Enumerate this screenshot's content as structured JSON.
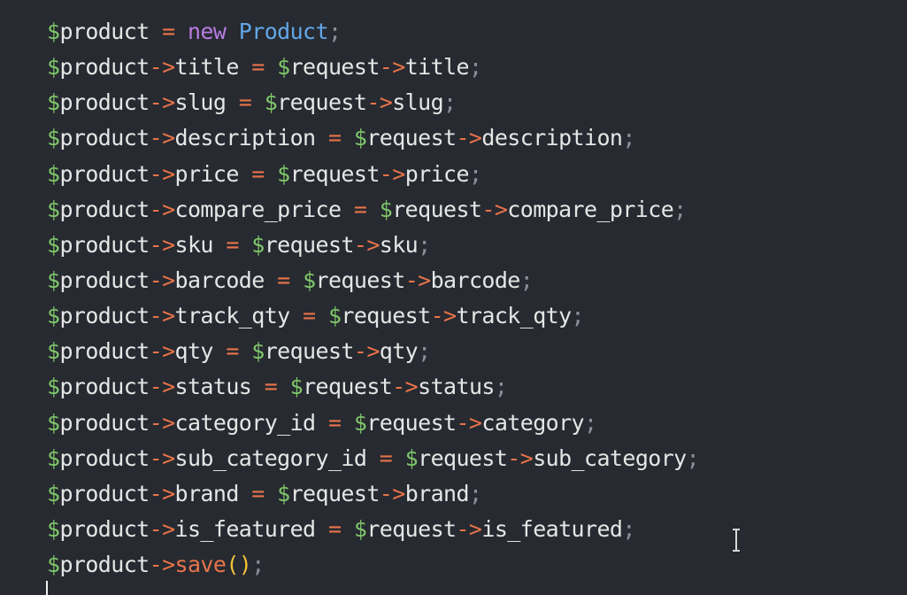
{
  "code": {
    "line1": {
      "var": "product",
      "op": " = ",
      "kw": "new",
      "cls": "Product",
      "semi": ";"
    },
    "lines": [
      {
        "prop": "title",
        "rhs": "title"
      },
      {
        "prop": "slug",
        "rhs": "slug"
      },
      {
        "prop": "description",
        "rhs": "description"
      },
      {
        "prop": "price",
        "rhs": "price"
      },
      {
        "prop": "compare_price",
        "rhs": "compare_price"
      },
      {
        "prop": "sku",
        "rhs": "sku"
      },
      {
        "prop": "barcode",
        "rhs": "barcode"
      },
      {
        "prop": "track_qty",
        "rhs": "track_qty"
      },
      {
        "prop": "qty",
        "rhs": "qty"
      },
      {
        "prop": "status",
        "rhs": "status"
      },
      {
        "prop": "category_id",
        "rhs": "category"
      },
      {
        "prop": "sub_category_id",
        "rhs": "sub_category"
      },
      {
        "prop": "brand",
        "rhs": "brand"
      },
      {
        "prop": "is_featured",
        "rhs": "is_featured"
      }
    ],
    "save_line": {
      "var": "product",
      "arrow": "->",
      "method": "save",
      "parens": "()",
      "semi": ";"
    },
    "symbols": {
      "dollar": "$",
      "arrow": "->",
      "assign": " = ",
      "semi": ";"
    },
    "lhs_var": "product",
    "rhs_var": "request"
  },
  "colors": {
    "background": "#272a30",
    "variable_sigil": "#7fc76b",
    "operator": "#e8744a",
    "keyword": "#b77ce0",
    "class": "#62a7e8",
    "punctuation": "#8a8f98",
    "parens": "#f2c23a"
  },
  "icons": {
    "mouse_pointer": "text-ibeam-cursor",
    "caret": "text-caret"
  }
}
